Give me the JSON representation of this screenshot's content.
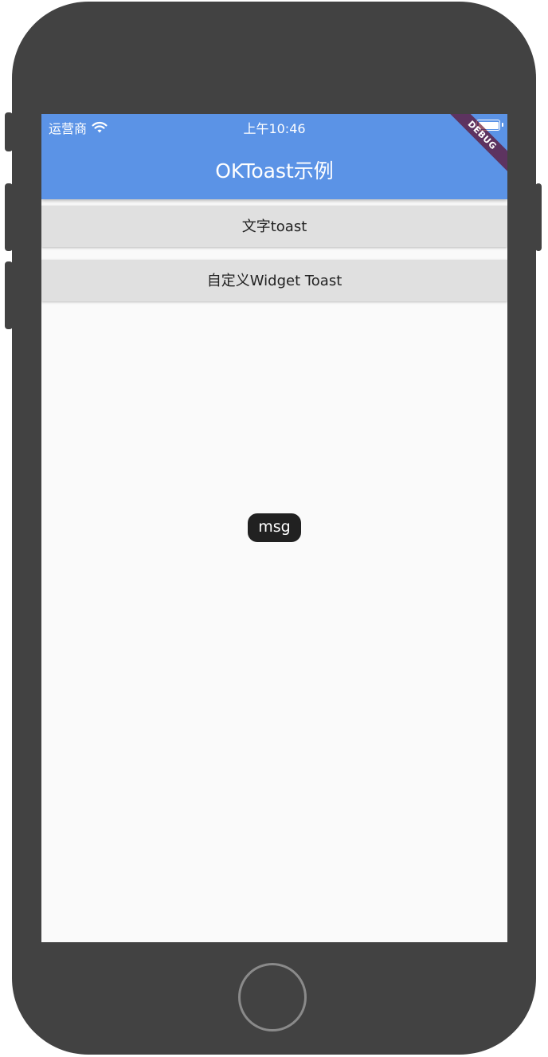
{
  "status_bar": {
    "carrier": "运营商",
    "time": "上午10:46"
  },
  "app_bar": {
    "title": "OKToast示例",
    "color": "#5b93e6"
  },
  "debug_banner": "DEBUG",
  "buttons": [
    {
      "label": "文字toast"
    },
    {
      "label": "自定义Widget Toast"
    }
  ],
  "toast": {
    "message": "msg"
  },
  "icons": {
    "wifi": "wifi-icon",
    "battery": "battery-icon",
    "home": "home-button"
  }
}
